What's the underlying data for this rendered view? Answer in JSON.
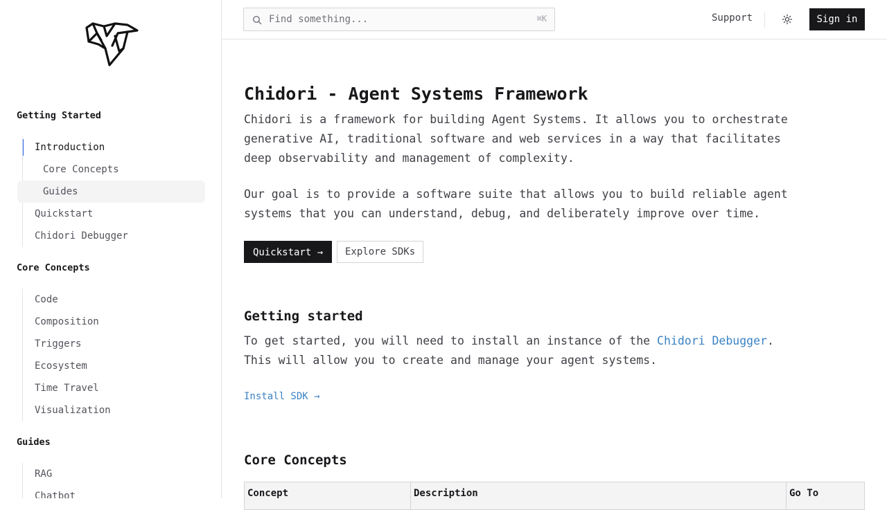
{
  "sidebar": {
    "sections": [
      {
        "heading": "Getting Started",
        "items": [
          {
            "label": "Introduction",
            "level": 1,
            "active": true
          },
          {
            "label": "Core Concepts",
            "level": 2
          },
          {
            "label": "Guides",
            "level": 2,
            "hover": true
          },
          {
            "label": "Quickstart",
            "level": 1
          },
          {
            "label": "Chidori Debugger",
            "level": 1
          }
        ]
      },
      {
        "heading": "Core Concepts",
        "items": [
          {
            "label": "Code",
            "level": 1
          },
          {
            "label": "Composition",
            "level": 1
          },
          {
            "label": "Triggers",
            "level": 1
          },
          {
            "label": "Ecosystem",
            "level": 1
          },
          {
            "label": "Time Travel",
            "level": 1
          },
          {
            "label": "Visualization",
            "level": 1
          }
        ]
      },
      {
        "heading": "Guides",
        "items": [
          {
            "label": "RAG",
            "level": 1
          },
          {
            "label": "Chatbot",
            "level": 1
          }
        ]
      }
    ]
  },
  "header": {
    "search_placeholder": "Find something...",
    "shortcut": "⌘K",
    "support": "Support",
    "sign_in": "Sign in"
  },
  "main": {
    "title": "Chidori - Agent Systems Framework",
    "intro_p1": "Chidori is a framework for building Agent Systems. It allows you to orchestrate generative AI, traditional software and web services in a way that facilitates deep observability and management of complexity.",
    "intro_p2": "Our goal is to provide a software suite that allows you to build reliable agent systems that you can understand, debug, and deliberately improve over time.",
    "quickstart_btn": "Quickstart →",
    "explore_btn": "Explore SDKs",
    "getting_started_heading": "Getting started",
    "gs_text_before": "To get started, you will need to install an instance of the ",
    "gs_link": "Chidori Debugger",
    "gs_text_after": ". This will allow you to create and manage your agent systems.",
    "install_link": "Install SDK →",
    "core_concepts_heading": "Core Concepts",
    "table_headers": [
      "Concept",
      "Description",
      "Go To"
    ]
  },
  "colors": {
    "accent": "#3b82c4",
    "active_indicator": "#2563eb",
    "primary_button": "#18181b"
  }
}
